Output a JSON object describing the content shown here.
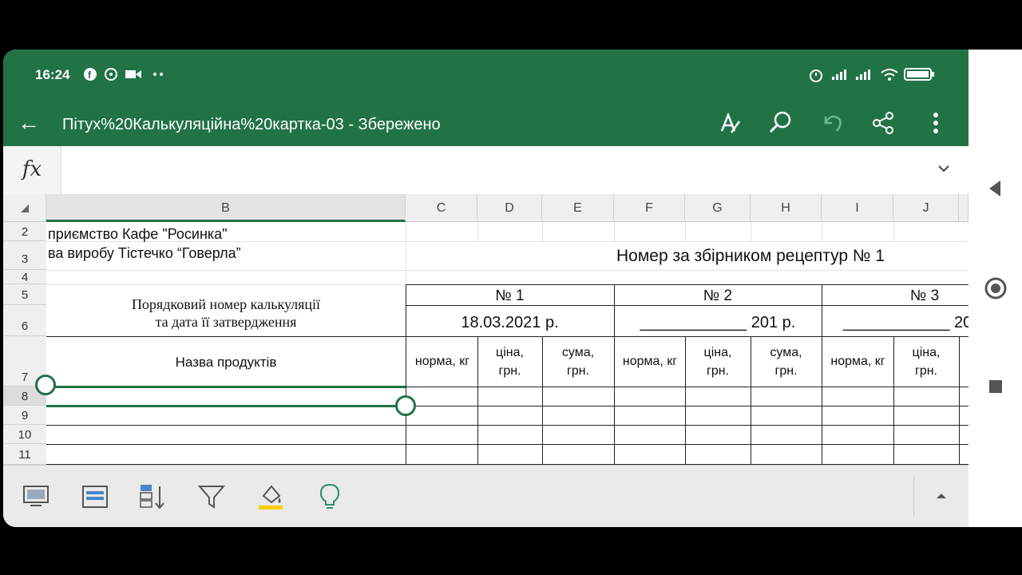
{
  "status": {
    "time": "16:24",
    "icons": [
      "facebook-icon",
      "viber-icon",
      "video-icon",
      "more-dots-icon",
      "alarm-icon",
      "signal-icon",
      "signal-icon",
      "wifi-icon",
      "battery-icon"
    ]
  },
  "titlebar": {
    "back": "←",
    "title": "Пітух%20Калькуляційна%20картка-03 - Збережено"
  },
  "formula": {
    "label": "fx",
    "value": ""
  },
  "columns": [
    "B",
    "C",
    "D",
    "E",
    "F",
    "G",
    "H",
    "I",
    "J"
  ],
  "rows": [
    "2",
    "3",
    "4",
    "5",
    "6",
    "7",
    "8",
    "9",
    "10",
    "11"
  ],
  "sheet": {
    "b2": "приємство Кафе \"Росинка\"",
    "b3": "ва виробу Тістечко “Говерла”",
    "recipe": "Номер за збірником рецептур № 1",
    "calc_line1": "Порядковий номер калькуляції",
    "calc_line2": "та дата її затвердження",
    "n1": "№ 1",
    "n2": "№ 2",
    "n3": "№ 3",
    "date1": "18.03.2021  р.",
    "date2": "____________ 201  р.",
    "date3": "____________ 20",
    "products": "Назва продуктів",
    "norm": "норма, кг",
    "price1": "ціна,",
    "price2": "грн.",
    "sum1": "сума,",
    "sum2": "грн."
  },
  "colors": {
    "accent": "#217346"
  }
}
